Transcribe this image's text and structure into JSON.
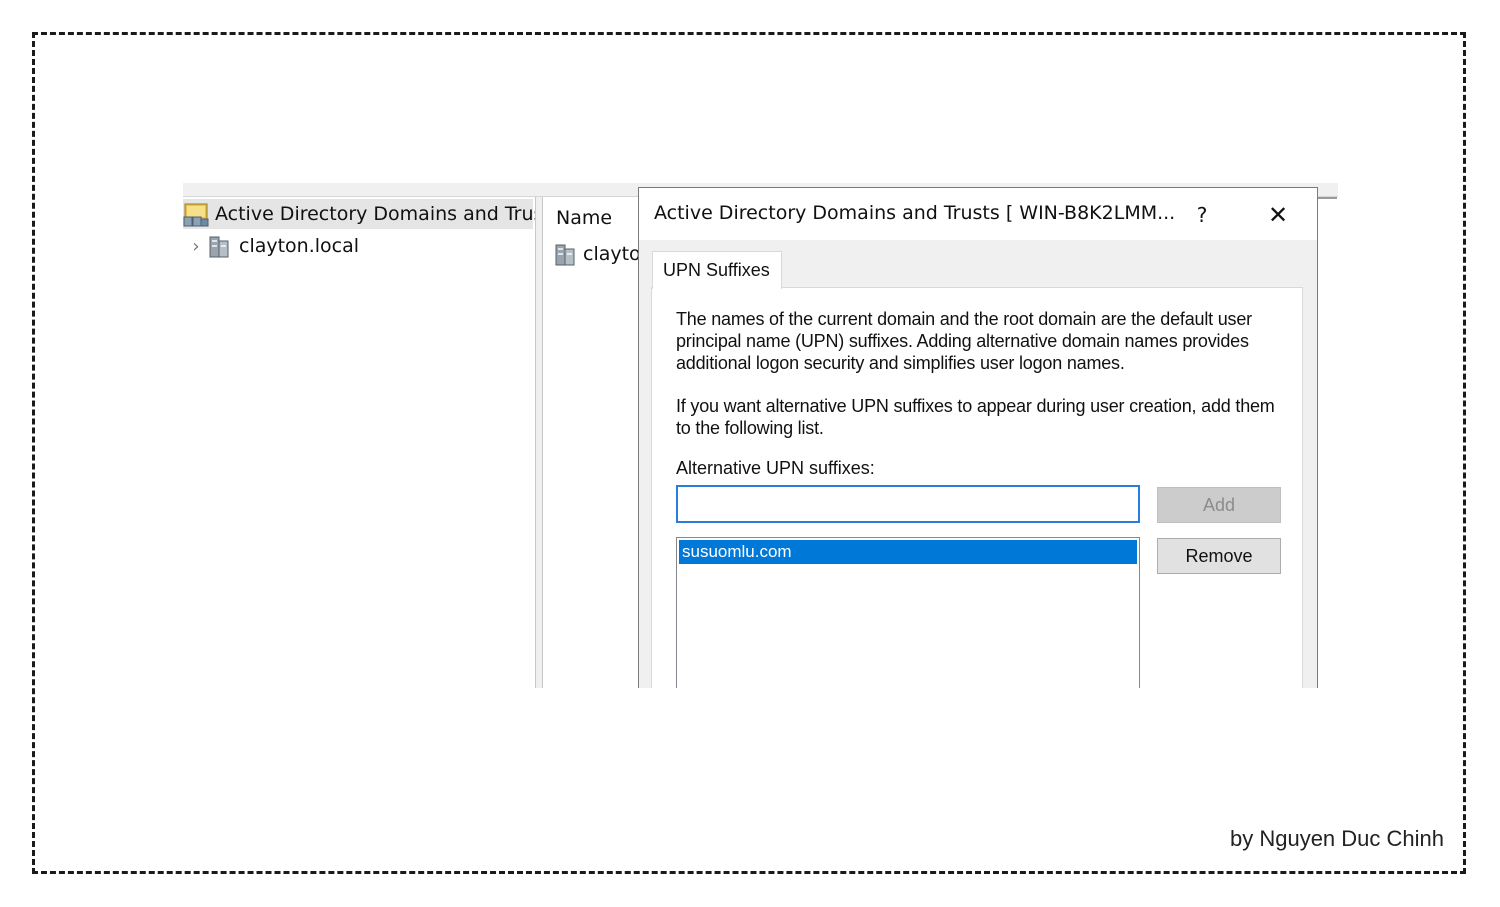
{
  "credit": "by Nguyen Duc Chinh",
  "tree": {
    "root_label": "Active Directory Domains and Trust",
    "child_label": "clayton.local"
  },
  "list": {
    "column_name": "Name",
    "item_label": "clayto"
  },
  "dialog": {
    "title": "Active Directory Domains and Trusts [ WIN-B8K2LMM...",
    "help_label": "?",
    "close_label": "✕",
    "tab_label": "UPN Suffixes",
    "paragraph_1": "The names of the current domain and the root domain are the default user principal name (UPN) suffixes. Adding alternative domain names provides additional logon security and simplifies user logon names.",
    "paragraph_2": "If you want alternative UPN suffixes to appear during user creation, add them to the following list.",
    "alt_label": "Alternative UPN suffixes:",
    "input_value": "",
    "add_label": "Add",
    "remove_label": "Remove",
    "suffixes": [
      "susuomlu.com"
    ]
  }
}
